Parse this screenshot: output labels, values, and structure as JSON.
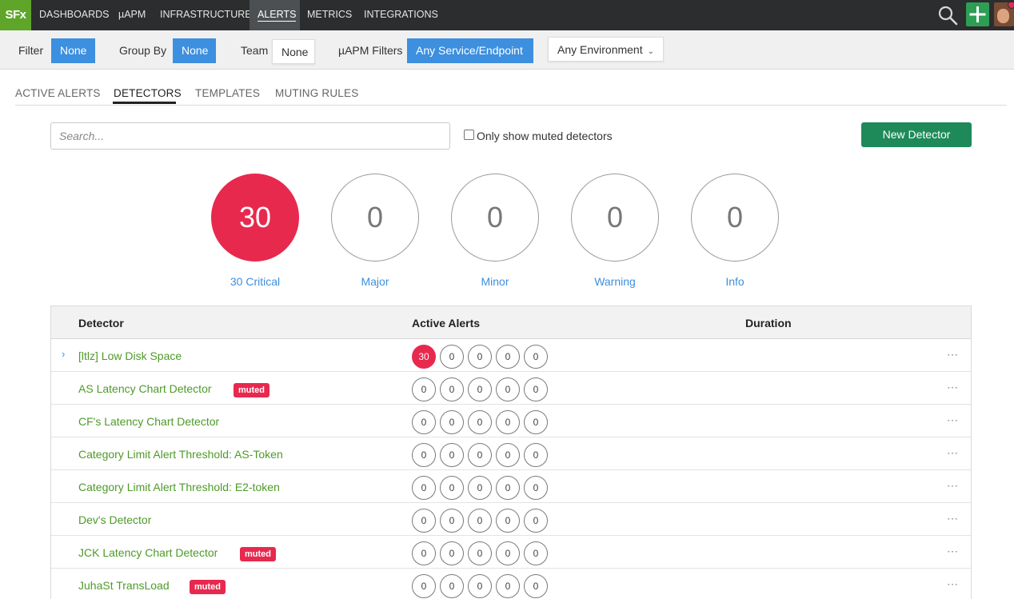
{
  "nav": {
    "logo": "SFx",
    "items": [
      "DASHBOARDS",
      "µAPM",
      "INFRASTRUCTURE",
      "ALERTS",
      "METRICS",
      "INTEGRATIONS"
    ],
    "active": "ALERTS"
  },
  "filters": {
    "filter_label": "Filter",
    "filter_value": "None",
    "groupby_label": "Group By",
    "groupby_value": "None",
    "team_label": "Team",
    "team_value": "None",
    "apm_label": "µAPM Filters",
    "apm_value": "Any Service/Endpoint",
    "env_value": "Any Environment"
  },
  "tabs": [
    "ACTIVE ALERTS",
    "DETECTORS",
    "TEMPLATES",
    "MUTING RULES"
  ],
  "active_tab": "DETECTORS",
  "search": {
    "placeholder": "Search..."
  },
  "muted_toggle": {
    "label": "Only show muted detectors",
    "checked": false
  },
  "new_detector_label": "New Detector",
  "severity_summary": [
    {
      "count": "30",
      "label": "30 Critical"
    },
    {
      "count": "0",
      "label": "Major"
    },
    {
      "count": "0",
      "label": "Minor"
    },
    {
      "count": "0",
      "label": "Warning"
    },
    {
      "count": "0",
      "label": "Info"
    }
  ],
  "table": {
    "headers": {
      "detector": "Detector",
      "active_alerts": "Active Alerts",
      "duration": "Duration"
    },
    "muted_tag": "muted",
    "more_icon": "⋯",
    "expand_icon": "›",
    "rows": [
      {
        "name": "[ltlz] Low Disk Space",
        "muted": false,
        "expandable": true,
        "alerts": [
          "30",
          "0",
          "0",
          "0",
          "0"
        ]
      },
      {
        "name": "AS Latency Chart Detector",
        "muted": true,
        "expandable": false,
        "alerts": [
          "0",
          "0",
          "0",
          "0",
          "0"
        ]
      },
      {
        "name": "CF's Latency Chart Detector",
        "muted": false,
        "expandable": false,
        "alerts": [
          "0",
          "0",
          "0",
          "0",
          "0"
        ]
      },
      {
        "name": "Category Limit Alert Threshold: AS-Token",
        "muted": false,
        "expandable": false,
        "alerts": [
          "0",
          "0",
          "0",
          "0",
          "0"
        ]
      },
      {
        "name": "Category Limit Alert Threshold: E2-token",
        "muted": false,
        "expandable": false,
        "alerts": [
          "0",
          "0",
          "0",
          "0",
          "0"
        ]
      },
      {
        "name": "Dev's Detector",
        "muted": false,
        "expandable": false,
        "alerts": [
          "0",
          "0",
          "0",
          "0",
          "0"
        ]
      },
      {
        "name": "JCK Latency Chart Detector",
        "muted": true,
        "expandable": false,
        "alerts": [
          "0",
          "0",
          "0",
          "0",
          "0"
        ]
      },
      {
        "name": "JuhaSt TransLoad",
        "muted": true,
        "expandable": false,
        "alerts": [
          "0",
          "0",
          "0",
          "0",
          "0"
        ]
      }
    ]
  },
  "colors": {
    "critical": "#e8294e",
    "link_blue": "#3d8fdf",
    "detector_green": "#4e9a28",
    "primary_button": "#1e8a5a",
    "logo_green": "#5fa52a",
    "nav_bg": "#2b2d2f"
  }
}
